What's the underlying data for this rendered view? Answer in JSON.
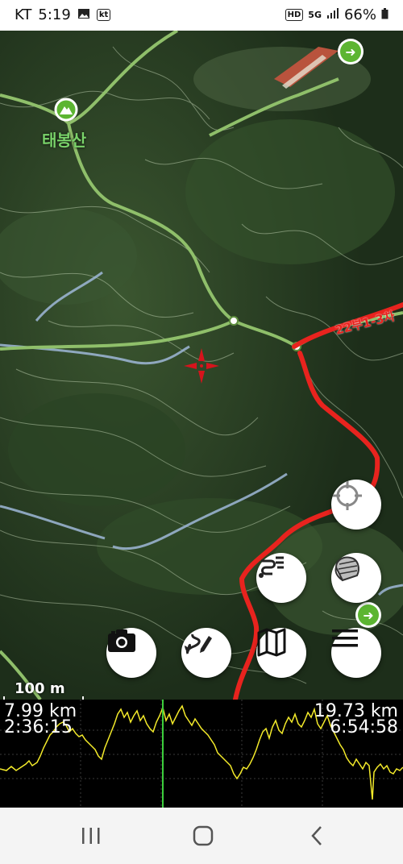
{
  "status_bar": {
    "carrier": "KT",
    "time": "5:19",
    "kt_badge": "kt",
    "hd_badge": "HD",
    "network": "5G",
    "battery": "66%"
  },
  "map": {
    "peak_label": "태봉산",
    "trail_label": "22부1-3차",
    "scale_label": "100 m"
  },
  "buttons": {
    "locate": "crosshair-icon",
    "track_list": "route-list-icon",
    "layers": "map-layers-icon",
    "camera": "camera-icon",
    "draw_route": "draw-route-icon",
    "map": "map-icon",
    "menu": "menu-icon"
  },
  "profile": {
    "left_distance": "7.99 km",
    "left_time": "2:36:15",
    "right_distance": "19.73 km",
    "right_time": "6:54:58"
  },
  "colors": {
    "track": "#e8231e",
    "trail": "#8fbf6a",
    "stream": "#9fb8d8",
    "profile_line": "#f3ea2a",
    "cursor": "#3ccf3c",
    "peak": "#5cb531"
  }
}
